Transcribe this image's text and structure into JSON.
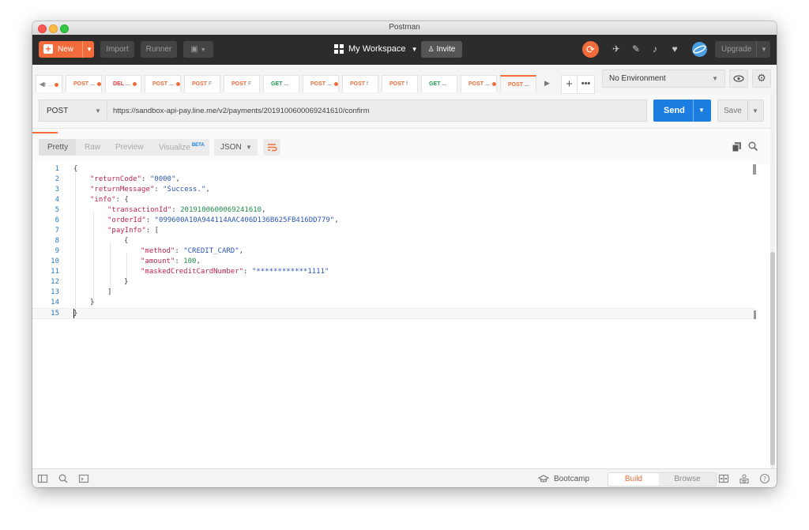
{
  "window": {
    "title": "Postman"
  },
  "header": {
    "new_label": "New",
    "import_label": "Import",
    "runner_label": "Runner",
    "workspace_label": "My Workspace",
    "invite_label": "Invite",
    "upgrade_label": "Upgrade"
  },
  "tabs": [
    {
      "method": "",
      "label": "r ..."
    },
    {
      "method": "POST",
      "label": " ..."
    },
    {
      "method": "DEL",
      "label": " ..."
    },
    {
      "method": "POST",
      "label": " ..."
    },
    {
      "method": "POST",
      "label": " F"
    },
    {
      "method": "POST",
      "label": " F"
    },
    {
      "method": "GET",
      "label": " ..."
    },
    {
      "method": "POST",
      "label": " ..."
    },
    {
      "method": "POST",
      "label": " f"
    },
    {
      "method": "POST",
      "label": " f"
    },
    {
      "method": "GET",
      "label": " ..."
    },
    {
      "method": "POST",
      "label": " ..."
    },
    {
      "method": "POST",
      "label": " ..."
    }
  ],
  "environment": {
    "selected": "No Environment"
  },
  "request": {
    "method": "POST",
    "url": "https://sandbox-api-pay.line.me/v2/payments/2019100600069241610/confirm",
    "send_label": "Send",
    "save_label": "Save"
  },
  "response_toolbar": {
    "pretty_label": "Pretty",
    "raw_label": "Raw",
    "preview_label": "Preview",
    "visualize_label": "Visualize",
    "beta_label": "BETA",
    "format_label": "JSON"
  },
  "footer": {
    "bootcamp_label": "Bootcamp",
    "build_label": "Build",
    "browse_label": "Browse"
  },
  "colors": {
    "accent": "#f26b3a",
    "send": "#1c7de0",
    "header_bg": "#2c2c2c"
  }
}
